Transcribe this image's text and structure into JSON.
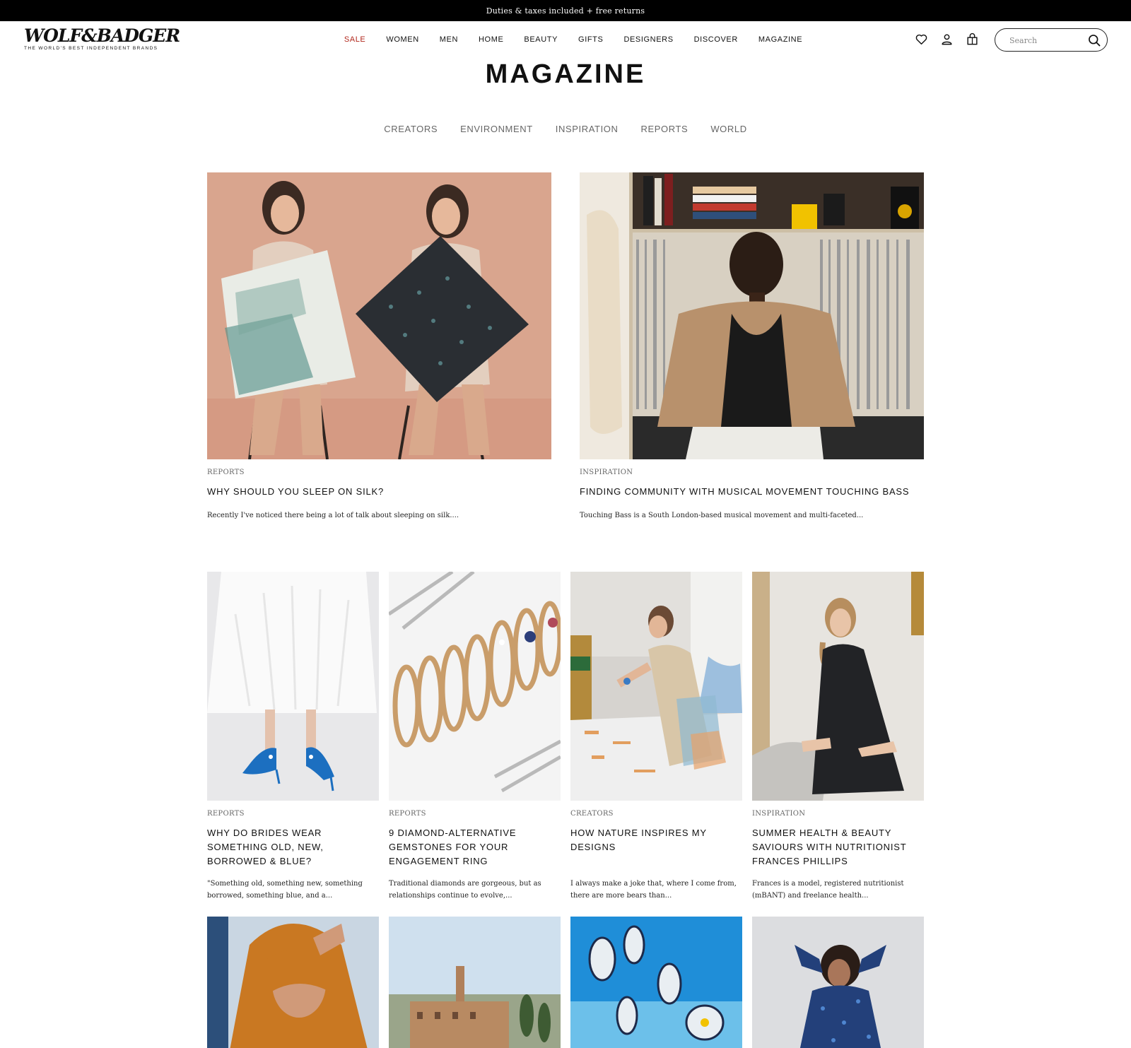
{
  "announcement": "Duties & taxes included + free returns",
  "logo": {
    "wordmark": "WOLF&BADGER",
    "tagline": "THE WORLD'S BEST INDEPENDENT BRANDS"
  },
  "nav": [
    "SALE",
    "WOMEN",
    "MEN",
    "HOME",
    "BEAUTY",
    "GIFTS",
    "DESIGNERS",
    "DISCOVER",
    "MAGAZINE"
  ],
  "header_icons": [
    "heart-icon",
    "account-icon",
    "bag-icon"
  ],
  "search": {
    "placeholder": "Search"
  },
  "page_title": "MAGAZINE",
  "subnav": [
    "CREATORS",
    "ENVIRONMENT",
    "INSPIRATION",
    "REPORTS",
    "WORLD"
  ],
  "featured": [
    {
      "category": "REPORTS",
      "title": "WHY SHOULD YOU SLEEP ON SILK?",
      "excerpt": "Recently I've noticed there being a lot of talk about sleeping on silk...."
    },
    {
      "category": "INSPIRATION",
      "title": "FINDING COMMUNITY WITH MUSICAL MOVEMENT TOUCHING BASS",
      "excerpt": "Touching Bass is a South London-based musical movement and multi-faceted..."
    }
  ],
  "articles": [
    {
      "category": "REPORTS",
      "title": "WHY DO BRIDES WEAR SOMETHING OLD, NEW, BORROWED & BLUE?",
      "excerpt": "\"Something old, something new, something borrowed, something blue, and a..."
    },
    {
      "category": "REPORTS",
      "title": "9 DIAMOND-ALTERNATIVE GEMSTONES FOR YOUR ENGAGEMENT RING",
      "excerpt": "Traditional diamonds are gorgeous, but as relationships continue to evolve,..."
    },
    {
      "category": "CREATORS",
      "title": "HOW NATURE INSPIRES MY DESIGNS",
      "excerpt": "I always make a joke that, where I come from, there are more bears than..."
    },
    {
      "category": "INSPIRATION",
      "title": "SUMMER HEALTH & BEAUTY SAVIOURS WITH NUTRITIONIST FRANCES PHILLIPS",
      "excerpt": "Frances is a model, registered nutritionist (mBANT) and freelance health..."
    }
  ],
  "colors": {
    "sale": "#b1261b",
    "announcement_bg": "#000000",
    "text": "#111111",
    "muted": "#666666"
  }
}
